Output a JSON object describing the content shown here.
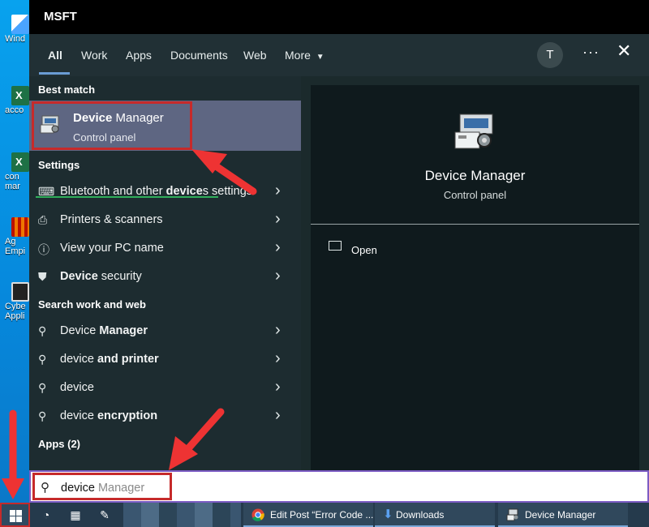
{
  "desktop": {
    "icons": [
      {
        "label": "Wind",
        "kind": "win"
      },
      {
        "label": "acco",
        "kind": "xls"
      },
      {
        "label": "con mar",
        "kind": "xls"
      },
      {
        "label": "Ag Empi",
        "kind": "zip"
      },
      {
        "label": "Cybe Appli",
        "kind": "app"
      }
    ]
  },
  "window": {
    "title": "MSFT"
  },
  "tabs": {
    "items": [
      "All",
      "Work",
      "Apps",
      "Documents",
      "Web",
      "More"
    ],
    "avatar_initial": "T",
    "more_options": "···"
  },
  "best_match": {
    "heading": "Best match",
    "title_bold": "Device",
    "title_rest": " Manager",
    "subtitle": "Control panel",
    "icon": "device-manager-icon"
  },
  "settings": {
    "heading": "Settings",
    "items": [
      {
        "pre": "Bluetooth and other ",
        "bold": "device",
        "post": "s settings",
        "icon": "bluetooth-devices-icon"
      },
      {
        "pre": "Printers & scanners",
        "bold": "",
        "post": "",
        "icon": "printer-icon"
      },
      {
        "pre": "View your PC name",
        "bold": "",
        "post": "",
        "icon": "pc-info-icon"
      },
      {
        "pre": "",
        "bold": "Device",
        "post": " security",
        "icon": "shield-icon"
      }
    ]
  },
  "web": {
    "heading": "Search work and web",
    "items": [
      {
        "pre": "Device ",
        "bold": "Manager",
        "post": ""
      },
      {
        "pre": "device ",
        "bold": "and printer",
        "post": ""
      },
      {
        "pre": "device",
        "bold": "",
        "post": ""
      },
      {
        "pre": "device ",
        "bold": "encryption",
        "post": ""
      }
    ]
  },
  "apps_heading": "Apps (2)",
  "preview": {
    "title": "Device Manager",
    "subtitle": "Control panel",
    "action_open": "Open"
  },
  "search": {
    "typed": "device",
    "suggestion": " Manager"
  },
  "taskbar": {
    "items": [
      {
        "label": "Edit Post “Error Code ...",
        "icon": "chrome-icon"
      },
      {
        "label": "Downloads",
        "icon": "download-icon"
      },
      {
        "label": "Device Manager",
        "icon": "device-manager-icon"
      }
    ]
  },
  "colors": {
    "accent_highlight": "#c62a2a",
    "best_match_bg": "#5e6682",
    "panel_bg": "#1d2c30",
    "preview_bg": "#0f1a1d"
  }
}
